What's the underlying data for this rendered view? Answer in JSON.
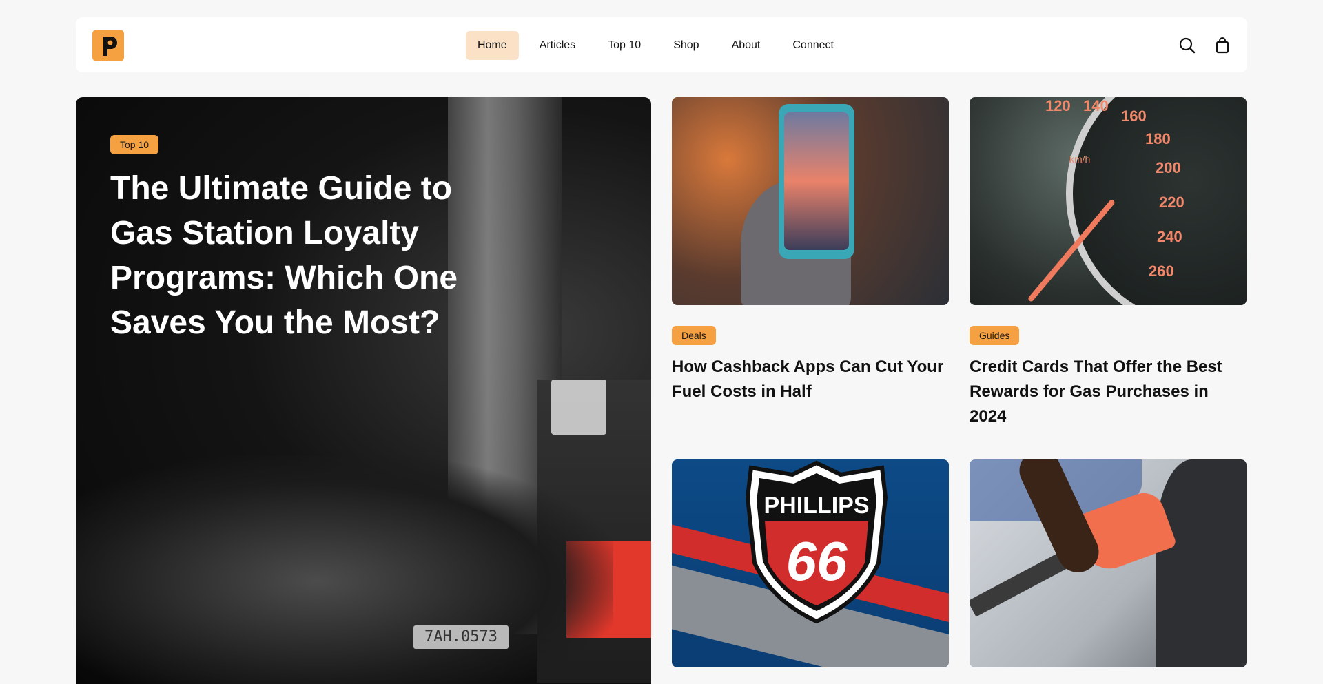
{
  "header": {
    "logo_icon": "p-logo-icon",
    "nav": [
      {
        "label": "Home",
        "active": true
      },
      {
        "label": "Articles"
      },
      {
        "label": "Top 10"
      },
      {
        "label": "Shop"
      },
      {
        "label": "About"
      },
      {
        "label": "Connect"
      }
    ],
    "icons": [
      "search-icon",
      "shopping-bag-icon"
    ]
  },
  "hero": {
    "badge": "Top 10",
    "title": "The Ultimate Guide to Gas Station Loyalty Programs: Which One Saves You the Most?",
    "plate_text": "7AH.0573"
  },
  "cards": [
    {
      "badge": "Deals",
      "title": "How Cashback Apps Can Cut Your Fuel Costs in Half"
    },
    {
      "badge": "Guides",
      "title": "Credit Cards That Offer the Best Rewards for Gas Purchases in 2024"
    },
    {
      "badge": "",
      "title": ""
    },
    {
      "badge": "",
      "title": ""
    }
  ],
  "speedo": {
    "unit": "km/h",
    "marks": [
      "120",
      "140",
      "160",
      "180",
      "200",
      "220",
      "240",
      "260"
    ]
  },
  "phillips": {
    "line1": "PHILLIPS",
    "line2": "66"
  },
  "colors": {
    "accent": "#f5a142",
    "nav_active_bg": "#fbe2c7",
    "page_bg": "#f7f7f7"
  }
}
